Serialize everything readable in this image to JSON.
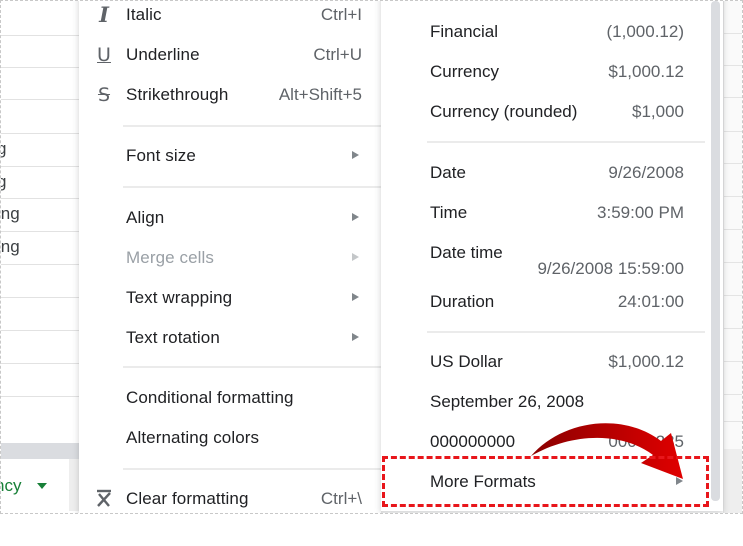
{
  "background_sheet": {
    "left_cells": [
      "g",
      "g",
      "ing",
      "ing"
    ],
    "sheet_tab_label": "ncy",
    "accent_color": "#188038"
  },
  "format_menu": {
    "items": [
      {
        "label": "Italic",
        "icon": "italic-icon",
        "glyph": "I",
        "shortcut": "Ctrl+I"
      },
      {
        "label": "Underline",
        "icon": "underline-icon",
        "glyph": "U",
        "shortcut": "Ctrl+U"
      },
      {
        "label": "Strikethrough",
        "icon": "strikethrough-icon",
        "glyph": "S",
        "shortcut": "Alt+Shift+5"
      },
      {
        "label": "Font size",
        "submenu": true
      },
      {
        "label": "Align",
        "submenu": true
      },
      {
        "label": "Merge cells",
        "submenu": true,
        "disabled": true
      },
      {
        "label": "Text wrapping",
        "submenu": true
      },
      {
        "label": "Text rotation",
        "submenu": true
      },
      {
        "label": "Conditional formatting"
      },
      {
        "label": "Alternating colors"
      },
      {
        "label": "Clear formatting",
        "icon": "clear-formatting-icon",
        "glyph": "✕",
        "shortcut": "Ctrl+\\"
      }
    ]
  },
  "number_menu": {
    "items": [
      {
        "label": "Financial",
        "value": "(1,000.12)"
      },
      {
        "label": "Currency",
        "value": "$1,000.12"
      },
      {
        "label": "Currency (rounded)",
        "value": "$1,000"
      },
      {
        "label": "Date",
        "value": "9/26/2008"
      },
      {
        "label": "Time",
        "value": "3:59:00 PM"
      },
      {
        "label": "Date time",
        "value": "9/26/2008 15:59:00"
      },
      {
        "label": "Duration",
        "value": "24:01:00"
      },
      {
        "label": "US Dollar",
        "value": "$1,000.12"
      },
      {
        "label": "September 26, 2008",
        "value": ""
      },
      {
        "label": "000000000",
        "value": "00001235"
      },
      {
        "label": "More Formats",
        "submenu": true
      }
    ]
  },
  "annotation": {
    "highlight_color": "#e8161b",
    "arrow_color": "#c00000",
    "target": "More Formats"
  }
}
